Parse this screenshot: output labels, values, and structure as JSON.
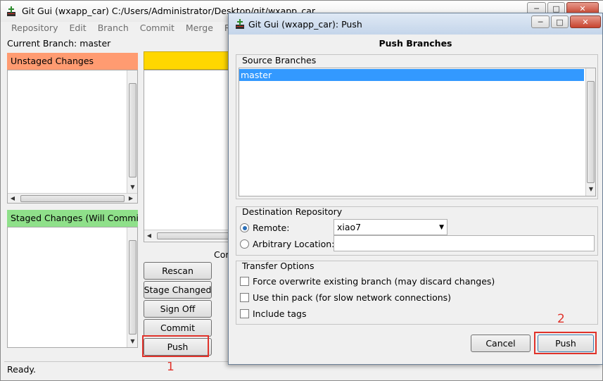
{
  "main_window": {
    "title": "Git Gui (wxapp_car) C:/Users/Administrator/Desktop/git/wxapp_car",
    "menu": [
      "Repository",
      "Edit",
      "Branch",
      "Commit",
      "Merge",
      "Remo"
    ],
    "current_branch": "Current Branch: master",
    "unstaged_header": "Unstaged Changes",
    "staged_header": "Staged Changes (Will Commit)",
    "commit_label_partial": "Cor",
    "buttons": {
      "rescan": "Rescan",
      "stage_changed": "Stage Changed",
      "sign_off": "Sign Off",
      "commit": "Commit",
      "push": "Push"
    },
    "status": "Ready."
  },
  "annotations": {
    "push_main_number": "1",
    "push_dialog_number": "2"
  },
  "push_dialog": {
    "title": "Git Gui (wxapp_car): Push",
    "heading": "Push Branches",
    "source_branches_label": "Source Branches",
    "branches": [
      "master"
    ],
    "destination_label": "Destination Repository",
    "remote_label": "Remote:",
    "remote_value": "xiao7",
    "arbitrary_label": "Arbitrary Location:",
    "arbitrary_value": "",
    "transfer_label": "Transfer Options",
    "options": {
      "force": "Force overwrite existing branch (may discard changes)",
      "thin_pack": "Use thin pack (for slow network connections)",
      "include_tags": "Include tags"
    },
    "cancel_label": "Cancel",
    "push_label": "Push"
  },
  "colors": {
    "unstaged_header": "#ff9b71",
    "staged_header": "#8fe08a",
    "diff_header": "#ffd700",
    "selection": "#3399ff",
    "highlight": "#e0322a"
  },
  "icons": {
    "minimize": "minimize-icon",
    "maximize": "maximize-icon",
    "close": "close-icon",
    "app": "git-gui-icon"
  }
}
